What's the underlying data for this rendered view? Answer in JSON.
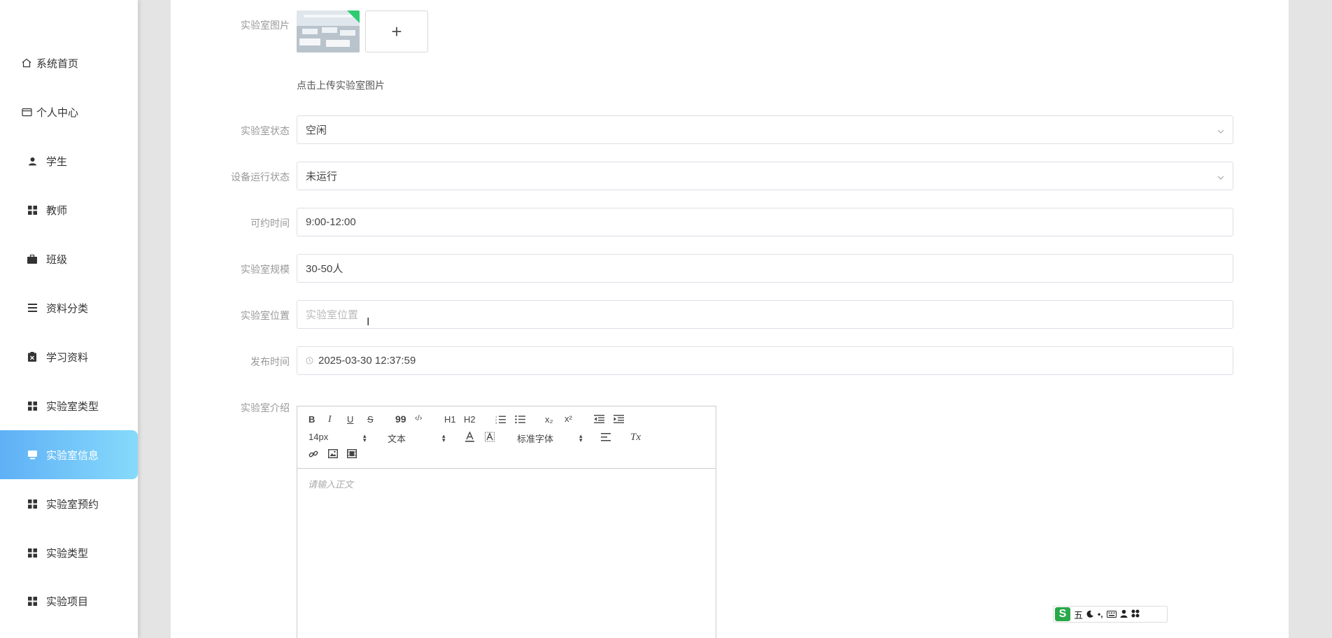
{
  "sidebar": {
    "items": [
      {
        "label": "系统首页",
        "icon": "home-icon"
      },
      {
        "label": "个人中心",
        "icon": "wallet-icon"
      },
      {
        "label": "学生",
        "icon": "user-icon"
      },
      {
        "label": "教师",
        "icon": "grid-icon"
      },
      {
        "label": "班级",
        "icon": "briefcase-icon"
      },
      {
        "label": "资料分类",
        "icon": "list-icon"
      },
      {
        "label": "学习资料",
        "icon": "clipboard-icon"
      },
      {
        "label": "实验室类型",
        "icon": "grid-icon"
      },
      {
        "label": "实验室信息",
        "icon": "monitor-icon",
        "active": true
      },
      {
        "label": "实验室预约",
        "icon": "grid-icon"
      },
      {
        "label": "实验类型",
        "icon": "grid-icon"
      },
      {
        "label": "实验项目",
        "icon": "grid-icon"
      }
    ],
    "active_color": "#6cc3f8"
  },
  "form": {
    "image": {
      "label": "实验室图片",
      "upload_hint": "点击上传实验室图片",
      "add_symbol": "+"
    },
    "status": {
      "label": "实验室状态",
      "value": "空闲"
    },
    "device_status": {
      "label": "设备运行状态",
      "value": "未运行"
    },
    "available_time": {
      "label": "可约时间",
      "value": "9:00-12:00"
    },
    "scale": {
      "label": "实验室规模",
      "value": "30-50人"
    },
    "location": {
      "label": "实验室位置",
      "placeholder": "实验室位置",
      "value": ""
    },
    "publish_time": {
      "label": "发布时间",
      "value": "2025-03-30 12:37:59"
    },
    "intro": {
      "label": "实验室介绍"
    }
  },
  "editor": {
    "toolbar": {
      "bold": "B",
      "italic": "I",
      "underline": "U",
      "strike": "S",
      "quote": "99",
      "code": "‹/›",
      "h1": "H1",
      "h2": "H2",
      "sub": "x₂",
      "sup": "x²",
      "font_size": "14px",
      "text_style": "文本",
      "font_family": "标准字体",
      "clean": "Tx"
    },
    "placeholder": "请输入正文"
  },
  "ime": {
    "logo": "S",
    "mode": "五"
  }
}
